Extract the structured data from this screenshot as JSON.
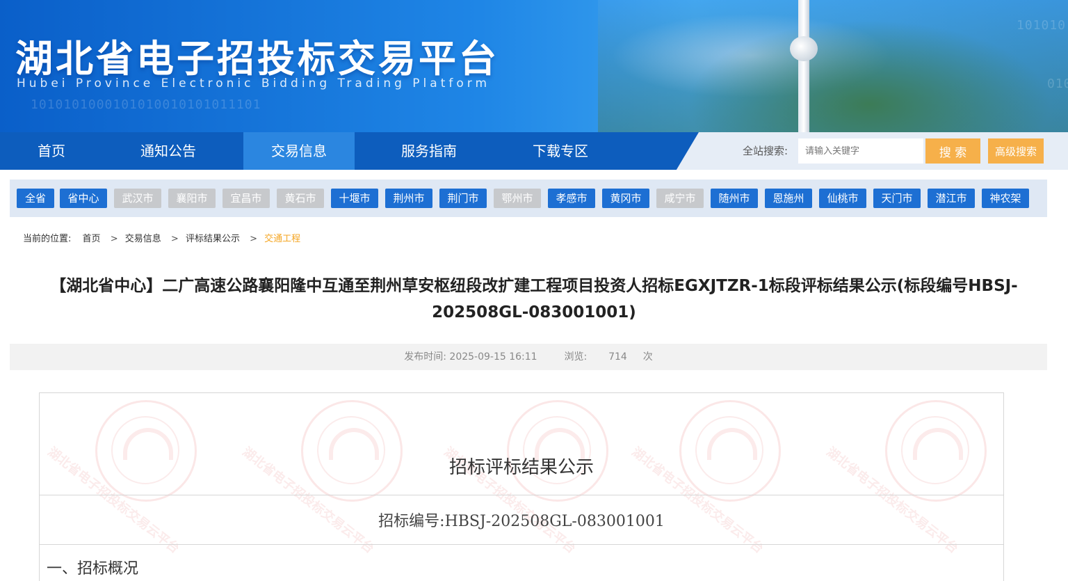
{
  "header": {
    "title": "湖北省电子招投标交易平台",
    "subtitle": "Hubei Province Electronic Bidding Trading Platform"
  },
  "nav": {
    "items": [
      {
        "label": "首页"
      },
      {
        "label": "通知公告"
      },
      {
        "label": "交易信息",
        "active": true
      },
      {
        "label": "服务指南"
      },
      {
        "label": "下载专区"
      }
    ]
  },
  "search": {
    "label": "全站搜索:",
    "placeholder": "请输入关键字",
    "button": "搜 索",
    "advanced": "高级搜索"
  },
  "regions": [
    {
      "label": "全省",
      "enabled": true
    },
    {
      "label": "省中心",
      "enabled": true
    },
    {
      "label": "武汉市",
      "enabled": false
    },
    {
      "label": "襄阳市",
      "enabled": false
    },
    {
      "label": "宜昌市",
      "enabled": false
    },
    {
      "label": "黄石市",
      "enabled": false
    },
    {
      "label": "十堰市",
      "enabled": true
    },
    {
      "label": "荆州市",
      "enabled": true
    },
    {
      "label": "荆门市",
      "enabled": true
    },
    {
      "label": "鄂州市",
      "enabled": false
    },
    {
      "label": "孝感市",
      "enabled": true
    },
    {
      "label": "黄冈市",
      "enabled": true
    },
    {
      "label": "咸宁市",
      "enabled": false
    },
    {
      "label": "随州市",
      "enabled": true
    },
    {
      "label": "恩施州",
      "enabled": true
    },
    {
      "label": "仙桃市",
      "enabled": true
    },
    {
      "label": "天门市",
      "enabled": true
    },
    {
      "label": "潜江市",
      "enabled": true
    },
    {
      "label": "神农架",
      "enabled": true
    }
  ],
  "breadcrumb": {
    "prefix": "当前的位置:",
    "items": [
      "首页",
      "交易信息",
      "评标结果公示"
    ],
    "current": "交通工程",
    "separator": ">"
  },
  "article": {
    "title_line1": "【湖北省中心】二广高速公路襄阳隆中互通至荆州草安枢纽段改扩建工程项目投资人招标EGXJTZR-1标段评标结果公示(标段编号HBSJ-",
    "title_line2": "202508GL-083001001)",
    "publish_label": "发布时间:",
    "publish_time": "2025-09-15 16:11",
    "views_label": "浏览:",
    "views": "714",
    "views_unit": "次"
  },
  "document": {
    "heading": "招标评标结果公示",
    "code_line": "招标编号:HBSJ-202508GL-083001001",
    "section_1": "一、招标概况",
    "watermark_text": "湖北省电子招投标交易云平台"
  },
  "colors": {
    "nav_blue": "#0d5dbd",
    "nav_active": "#2b86e0",
    "region_on": "#1d6fd3",
    "region_off": "#c7c9cc",
    "accent_orange": "#f6b04a",
    "breadcrumb_current": "#f5a623"
  }
}
